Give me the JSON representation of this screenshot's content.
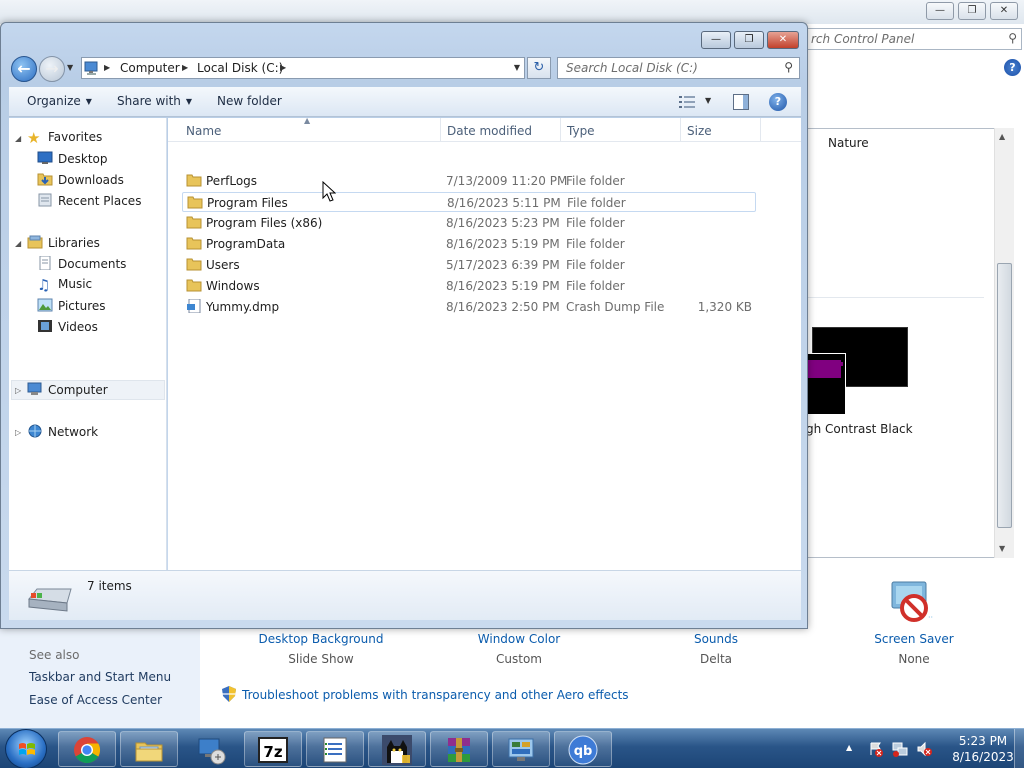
{
  "control_panel": {
    "search_placeholder": "rch Control Panel",
    "help_glyph": "?",
    "themes": {
      "nature": "Nature",
      "high_contrast_black": "gh Contrast Black"
    },
    "sidebar": {
      "see_also": "See also",
      "links": [
        "Taskbar and Start Menu",
        "Ease of Access Center"
      ]
    },
    "personalize": [
      {
        "label": "Desktop Background",
        "sub": "Slide Show"
      },
      {
        "label": "Window Color",
        "sub": "Custom"
      },
      {
        "label": "Sounds",
        "sub": "Delta"
      },
      {
        "label": "Screen Saver",
        "sub": "None"
      }
    ],
    "troubleshoot": "Troubleshoot problems with transparency and other Aero effects"
  },
  "explorer": {
    "breadcrumb": [
      "Computer",
      "Local Disk (C:)"
    ],
    "search_placeholder": "Search Local Disk (C:)",
    "toolbar": {
      "organize": "Organize",
      "share_with": "Share with",
      "new_folder": "New folder",
      "help_glyph": "?"
    },
    "nav": {
      "favorites": "Favorites",
      "favorites_items": [
        "Desktop",
        "Downloads",
        "Recent Places"
      ],
      "libraries": "Libraries",
      "libraries_items": [
        "Documents",
        "Music",
        "Pictures",
        "Videos"
      ],
      "computer": "Computer",
      "network": "Network"
    },
    "columns": {
      "name": "Name",
      "date": "Date modified",
      "type": "Type",
      "size": "Size"
    },
    "files": [
      {
        "name": "PerfLogs",
        "date": "7/13/2009 11:20 PM",
        "type": "File folder",
        "size": ""
      },
      {
        "name": "Program Files",
        "date": "8/16/2023 5:11 PM",
        "type": "File folder",
        "size": ""
      },
      {
        "name": "Program Files (x86)",
        "date": "8/16/2023 5:23 PM",
        "type": "File folder",
        "size": ""
      },
      {
        "name": "ProgramData",
        "date": "8/16/2023 5:19 PM",
        "type": "File folder",
        "size": ""
      },
      {
        "name": "Users",
        "date": "5/17/2023 6:39 PM",
        "type": "File folder",
        "size": ""
      },
      {
        "name": "Windows",
        "date": "8/16/2023 5:19 PM",
        "type": "File folder",
        "size": ""
      },
      {
        "name": "Yummy.dmp",
        "date": "8/16/2023 2:50 PM",
        "type": "Crash Dump File",
        "size": "1,320 KB"
      }
    ],
    "status": "7 items"
  },
  "taskbar": {
    "apps": [
      "chrome-icon",
      "explorer-icon",
      "network-icon",
      "7zip-icon",
      "notepad-icon",
      "cat-app-icon",
      "winrar-icon",
      "control-panel-icon",
      "qbittorrent-icon"
    ],
    "qb_label": "qb",
    "sevenzip_label": "7z",
    "clock_time": "5:23 PM",
    "clock_date": "8/16/2023"
  },
  "colors": {
    "accent": "#2a5588",
    "link": "#0b5cad",
    "folder": "#e8c45a"
  }
}
